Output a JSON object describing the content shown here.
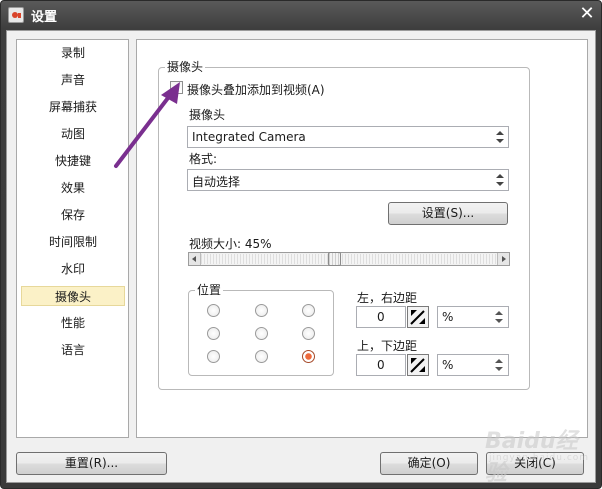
{
  "window": {
    "title": "设置"
  },
  "sidebar": {
    "items": [
      {
        "label": "录制"
      },
      {
        "label": "声音"
      },
      {
        "label": "屏幕捕获"
      },
      {
        "label": "动图"
      },
      {
        "label": "快捷键"
      },
      {
        "label": "效果"
      },
      {
        "label": "保存"
      },
      {
        "label": "时间限制"
      },
      {
        "label": "水印"
      },
      {
        "label": "摄像头",
        "active": true
      },
      {
        "label": "性能"
      },
      {
        "label": "语言"
      }
    ]
  },
  "camera": {
    "group_title": "摄像头",
    "overlay_checkbox_label": "摄像头叠加添加到视频(A)",
    "overlay_checked": false,
    "device_label": "摄像头",
    "device_value": "Integrated Camera",
    "format_label": "格式:",
    "format_value": "自动选择",
    "settings_button": "设置(S)...",
    "size_label": "视频大小: 45%",
    "size_percent": 45,
    "position_title": "位置",
    "position_selected": 8,
    "lr_margin_label": "左，右边距",
    "lr_margin_value": "0",
    "lr_unit": "%",
    "tb_margin_label": "上，下边距",
    "tb_margin_value": "0",
    "tb_unit": "%"
  },
  "footer": {
    "reset_button": "重置(R)...",
    "ok_button": "确定(O)",
    "close_button": "关闭(C)"
  },
  "watermark": {
    "text": "Baidu经验",
    "sub": "jingyan.baidu.com"
  },
  "colors": {
    "annotation_arrow": "#7a2f8f",
    "selected_radio": "#ee6a3c",
    "active_nav": "#fbf1c7"
  }
}
